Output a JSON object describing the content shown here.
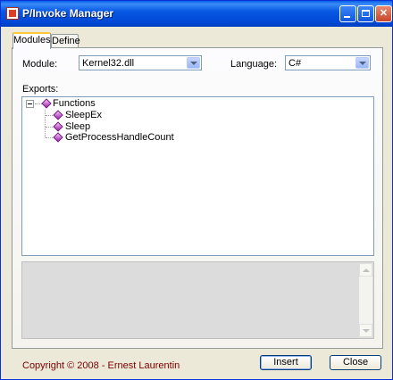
{
  "window": {
    "title": "P/Invoke Manager"
  },
  "tabs": [
    {
      "label": "Modules"
    },
    {
      "label": "Define"
    }
  ],
  "module": {
    "label": "Module:",
    "value": "Kernel32.dll"
  },
  "language": {
    "label": "Language:",
    "value": "C#"
  },
  "exports": {
    "label": "Exports:",
    "root": "Functions",
    "items": [
      {
        "label": "SleepEx"
      },
      {
        "label": "Sleep"
      },
      {
        "label": "GetProcessHandleCount"
      }
    ]
  },
  "footer": {
    "copyright": "Copyright © 2008 - Ernest Laurentin"
  },
  "buttons": {
    "insert": "Insert",
    "close": "Close"
  },
  "colors": {
    "titlebar": "#0054e3",
    "copyright": "#7a0000",
    "tree_node_icon": "#a020b0"
  }
}
